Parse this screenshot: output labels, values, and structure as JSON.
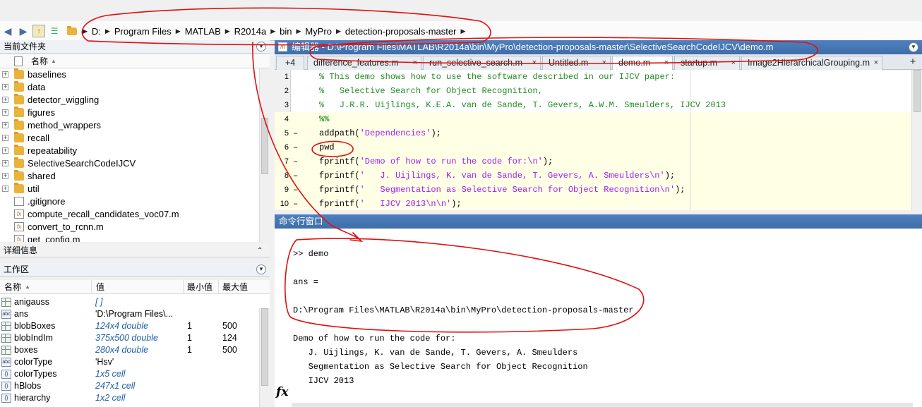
{
  "address_bar": {
    "crumbs": [
      "D:",
      "Program Files",
      "MATLAB",
      "R2014a",
      "bin",
      "MyPro",
      "detection-proposals-master"
    ]
  },
  "current_folder": {
    "title": "当前文件夹",
    "column_name": "名称",
    "items": [
      {
        "name": "baselines",
        "type": "folder"
      },
      {
        "name": "data",
        "type": "folder"
      },
      {
        "name": "detector_wiggling",
        "type": "folder"
      },
      {
        "name": "figures",
        "type": "folder"
      },
      {
        "name": "method_wrappers",
        "type": "folder"
      },
      {
        "name": "recall",
        "type": "folder"
      },
      {
        "name": "repeatability",
        "type": "folder"
      },
      {
        "name": "SelectiveSearchCodeIJCV",
        "type": "folder"
      },
      {
        "name": "shared",
        "type": "folder"
      },
      {
        "name": "util",
        "type": "folder"
      },
      {
        "name": ".gitignore",
        "type": "file"
      },
      {
        "name": "compute_recall_candidates_voc07.m",
        "type": "m"
      },
      {
        "name": "convert_to_rcnn.m",
        "type": "m"
      },
      {
        "name": "get_config.m",
        "type": "m"
      }
    ]
  },
  "details": {
    "title": "详细信息"
  },
  "workspace": {
    "title": "工作区",
    "headers": {
      "name": "名称",
      "value": "值",
      "min": "最小值",
      "max": "最大值"
    },
    "rows": [
      {
        "name": "anigauss",
        "value": "[ ]",
        "min": "",
        "max": "",
        "italic": true,
        "icon": "grid"
      },
      {
        "name": "ans",
        "value": "'D:\\Program Files\\...",
        "min": "",
        "max": "",
        "italic": false,
        "icon": "abc"
      },
      {
        "name": "blobBoxes",
        "value": "124x4 double",
        "min": "1",
        "max": "500",
        "italic": true,
        "icon": "grid"
      },
      {
        "name": "blobIndIm",
        "value": "375x500 double",
        "min": "1",
        "max": "124",
        "italic": true,
        "icon": "grid"
      },
      {
        "name": "boxes",
        "value": "280x4 double",
        "min": "1",
        "max": "500",
        "italic": true,
        "icon": "grid"
      },
      {
        "name": "colorType",
        "value": "'Hsv'",
        "min": "",
        "max": "",
        "italic": false,
        "icon": "abc"
      },
      {
        "name": "colorTypes",
        "value": "1x5 cell",
        "min": "",
        "max": "",
        "italic": true,
        "icon": "cell"
      },
      {
        "name": "hBlobs",
        "value": "247x1 cell",
        "min": "",
        "max": "",
        "italic": true,
        "icon": "cell"
      },
      {
        "name": "hierarchy",
        "value": "1x2 cell",
        "min": "",
        "max": "",
        "italic": true,
        "icon": "cell"
      }
    ]
  },
  "editor": {
    "title": "编辑器 - D:\\Program Files\\MATLAB\\R2014a\\bin\\MyPro\\detection-proposals-master\\SelectiveSearchCodeIJCV\\demo.m",
    "overflow_tabs": "+4",
    "tabs": [
      "difference_features.m",
      "run_selective_search.m",
      "Untitled.m",
      "demo.m",
      "startup.m",
      "Image2HierarchicalGrouping.m"
    ],
    "active_tab": "demo.m",
    "lines": [
      {
        "n": "1",
        "dash": "",
        "code": "% This demo shows how to use the software described in our IJCV paper:",
        "kind": "cmt"
      },
      {
        "n": "2",
        "dash": "",
        "code": "%   Selective Search for Object Recognition,",
        "kind": "cmt"
      },
      {
        "n": "3",
        "dash": "",
        "code": "%   J.R.R. Uijlings, K.E.A. van de Sande, T. Gevers, A.W.M. Smeulders, IJCV 2013",
        "kind": "cmt"
      },
      {
        "n": "4",
        "dash": "",
        "code": "%%",
        "kind": "cell"
      },
      {
        "n": "5",
        "dash": "–",
        "pre": "addpath(",
        "str": "'Dependencies'",
        "post": ");",
        "kind": "mix"
      },
      {
        "n": "6",
        "dash": "–",
        "code": "pwd",
        "kind": "plain"
      },
      {
        "n": "7",
        "dash": "–",
        "pre": "fprintf(",
        "str": "'Demo of how to run the code for:\\n'",
        "post": ");",
        "kind": "mix"
      },
      {
        "n": "8",
        "dash": "–",
        "pre": "fprintf(",
        "str": "'   J. Uijlings, K. van de Sande, T. Gevers, A. Smeulders\\n'",
        "post": ");",
        "kind": "mix"
      },
      {
        "n": "9",
        "dash": "–",
        "pre": "fprintf(",
        "str": "'   Segmentation as Selective Search for Object Recognition\\n'",
        "post": ");",
        "kind": "mix"
      },
      {
        "n": "10",
        "dash": "–",
        "pre": "fprintf(",
        "str": "'   IJCV 2013\\n\\n'",
        "post": ");",
        "kind": "mix"
      }
    ]
  },
  "command_window": {
    "title": "命令行窗口",
    "prompt": ">> demo",
    "lines": [
      "ans =",
      "D:\\Program Files\\MATLAB\\R2014a\\bin\\MyPro\\detection-proposals-master",
      "Demo of how to run the code for:",
      "   J. Uijlings, K. van de Sande, T. Gevers, A. Smeulders",
      "   Segmentation as Selective Search for Object Recognition",
      "   IJCV 2013"
    ],
    "fx": "fx"
  }
}
